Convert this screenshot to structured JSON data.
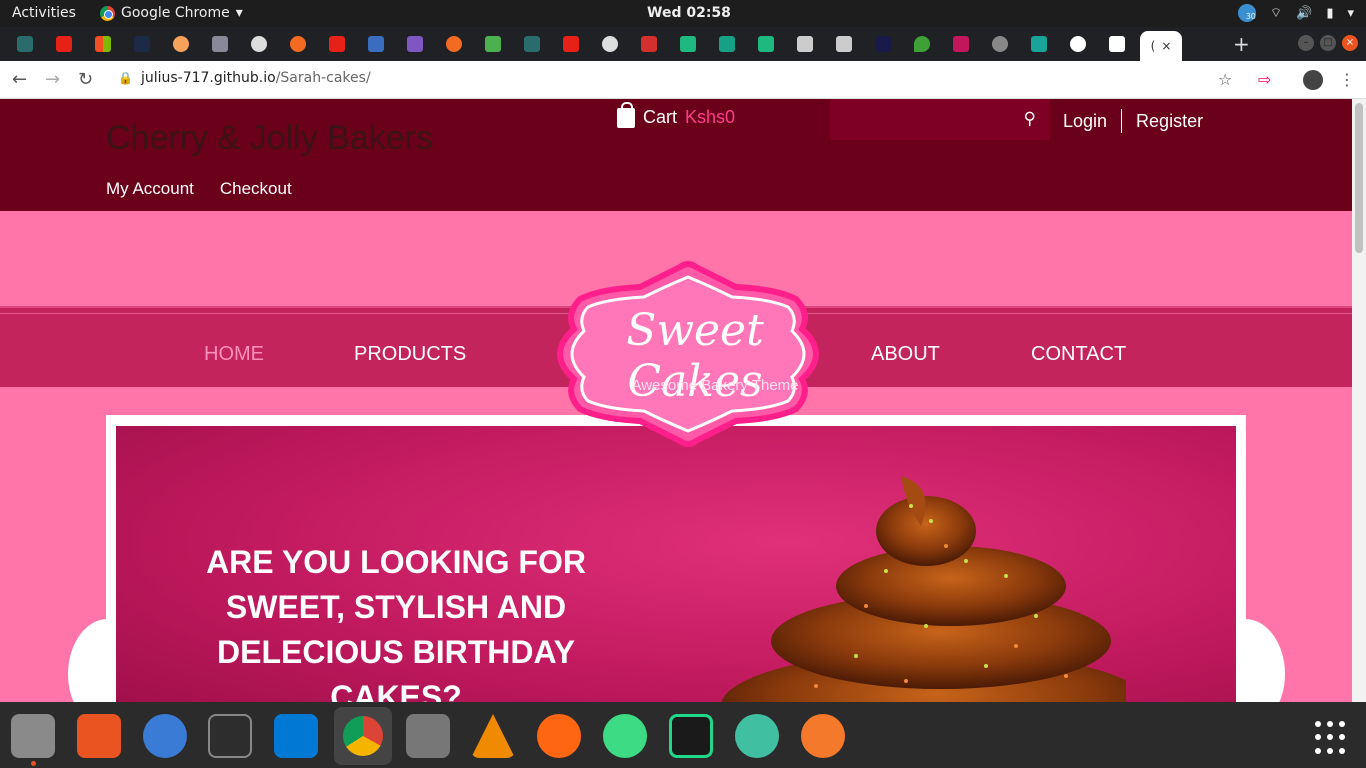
{
  "system": {
    "activities": "Activities",
    "app_name": "Google Chrome",
    "clock": "Wed 02:58",
    "tray_badge": "30"
  },
  "browser": {
    "tab_close": "×",
    "active_tab_label": "(",
    "new_tab": "+",
    "url_host": "julius-717.github.io",
    "url_path": "/Sarah-cakes/"
  },
  "site": {
    "brand": "Cherry & Jolly Bakers",
    "account_links": [
      "My Account",
      "Checkout"
    ],
    "cart_label": "Cart",
    "cart_amount": "Kshs0",
    "login": "Login",
    "register": "Register",
    "nav": [
      "HOME",
      "PRODUCTS",
      "ABOUT",
      "CONTACT"
    ],
    "logo_title": "Sweet Cakes",
    "logo_tagline": "Awesome Bakery Theme",
    "hero_lines": [
      "ARE YOU LOOKING FOR",
      "SWEET, STYLISH AND",
      "DELECIOUS BIRTHDAY",
      "CAKES?"
    ]
  },
  "colors": {
    "header_bg": "#6a0019",
    "page_bg": "#ff75aa",
    "nav_band": "#c4245c",
    "accent_pink": "#ff3d8a"
  }
}
